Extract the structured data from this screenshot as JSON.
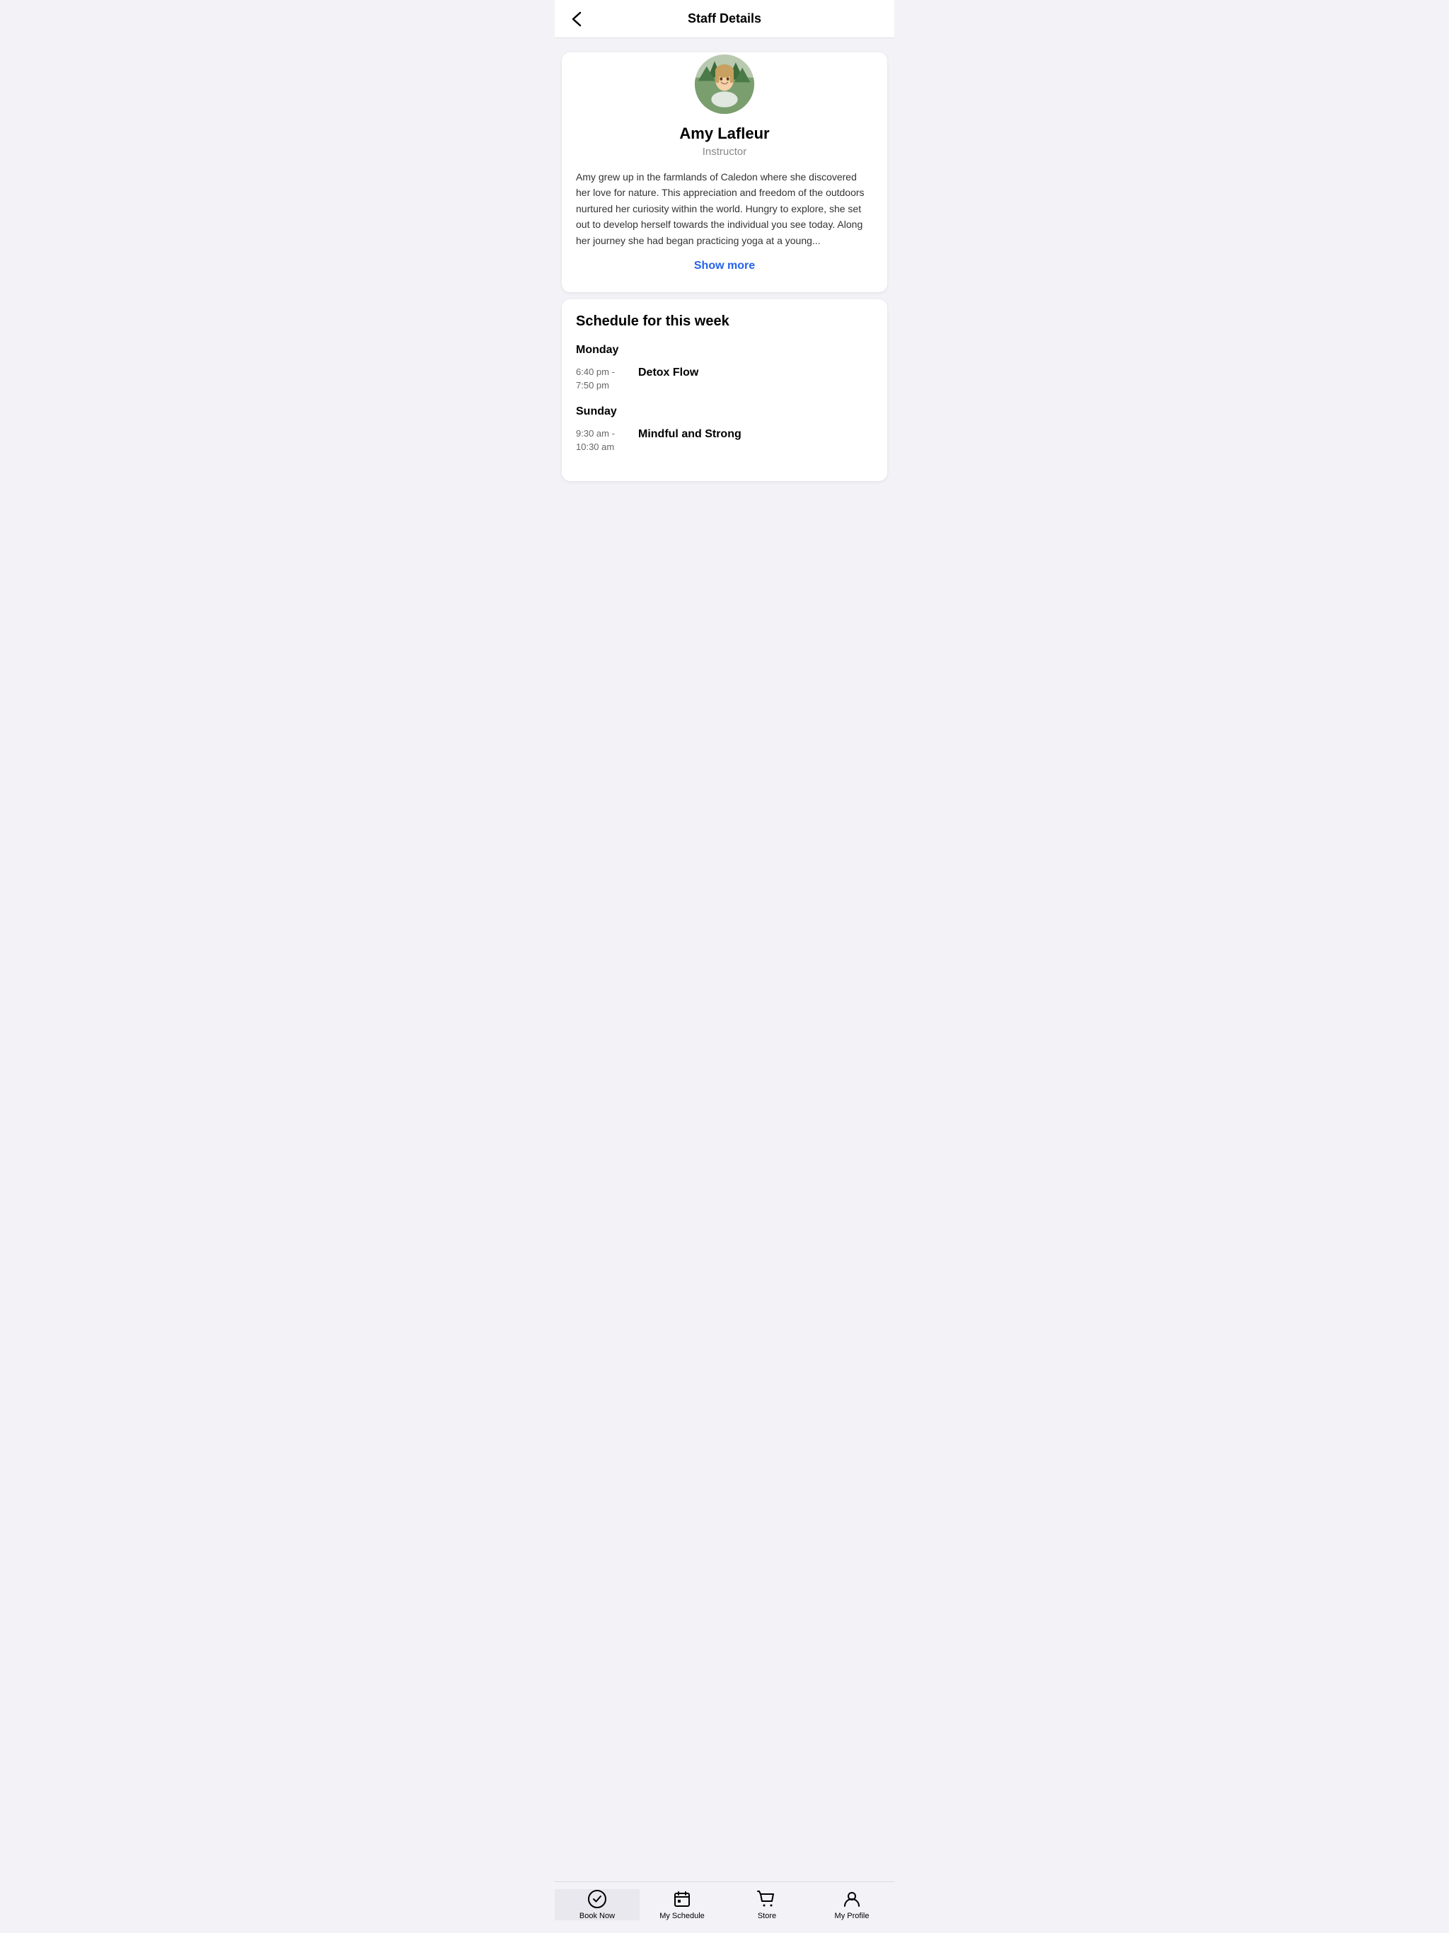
{
  "header": {
    "title": "Staff Details",
    "back_label": "‹"
  },
  "profile": {
    "name": "Amy Lafleur",
    "role": "Instructor",
    "bio": "Amy grew up in the farmlands of Caledon where she discovered her love for nature. This appreciation and freedom of the outdoors nurtured her curiosity within the world. Hungry to explore, she set out to develop herself towards the individual you see today. Along her journey she had began practicing yoga at a young...",
    "show_more_label": "Show more"
  },
  "schedule": {
    "section_title": "Schedule for this week",
    "days": [
      {
        "day": "Monday",
        "classes": [
          {
            "time_start": "6:40 pm -",
            "time_end": "7:50 pm",
            "class_name": "Detox Flow"
          }
        ]
      },
      {
        "day": "Sunday",
        "classes": [
          {
            "time_start": "9:30 am -",
            "time_end": "10:30 am",
            "class_name": "Mindful and Strong"
          }
        ]
      }
    ]
  },
  "nav": {
    "items": [
      {
        "id": "book-now",
        "label": "Book Now",
        "active": true
      },
      {
        "id": "my-schedule",
        "label": "My Schedule",
        "active": false
      },
      {
        "id": "store",
        "label": "Store",
        "active": false
      },
      {
        "id": "my-profile",
        "label": "My Profile",
        "active": false
      }
    ]
  }
}
